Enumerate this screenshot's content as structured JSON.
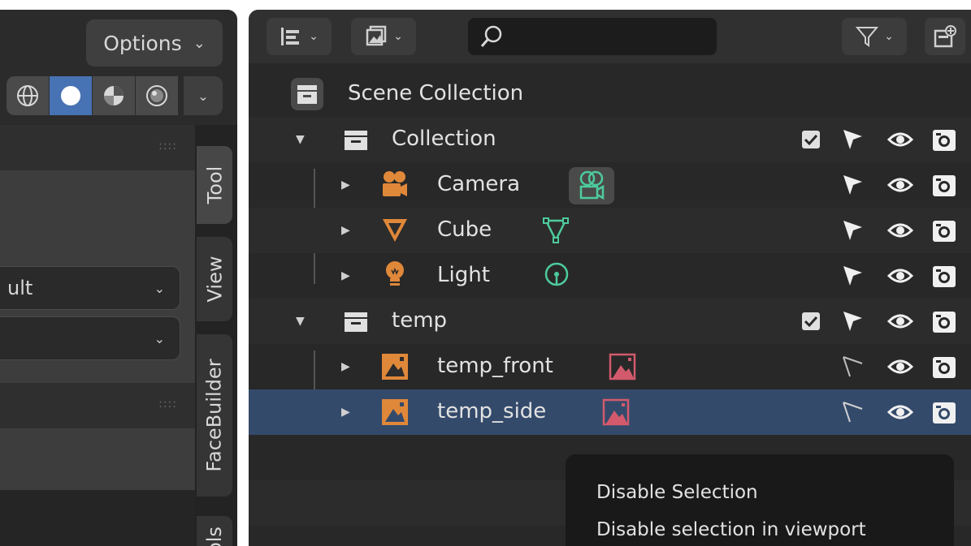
{
  "left_panel": {
    "options_label": "Options",
    "field1_value": "ult",
    "field2_value": "",
    "tabs": [
      "Tool",
      "View",
      "FaceBuilder",
      "ols"
    ]
  },
  "outliner": {
    "scene_collection": "Scene Collection",
    "rows": [
      {
        "label": "Collection",
        "kind": "collection"
      },
      {
        "label": "Camera",
        "kind": "camera"
      },
      {
        "label": "Cube",
        "kind": "mesh"
      },
      {
        "label": "Light",
        "kind": "light"
      },
      {
        "label": "temp",
        "kind": "collection"
      },
      {
        "label": "temp_front",
        "kind": "image"
      },
      {
        "label": "temp_side",
        "kind": "image",
        "selected": true
      }
    ],
    "tooltip": {
      "title": "Disable Selection",
      "description": "Disable selection in viewport"
    }
  },
  "colors": {
    "accent": "#4772b3",
    "object_orange": "#e0883a",
    "data_green": "#4dcb9d",
    "image_red": "#d25a6c",
    "selected_row": "#344a6b"
  }
}
